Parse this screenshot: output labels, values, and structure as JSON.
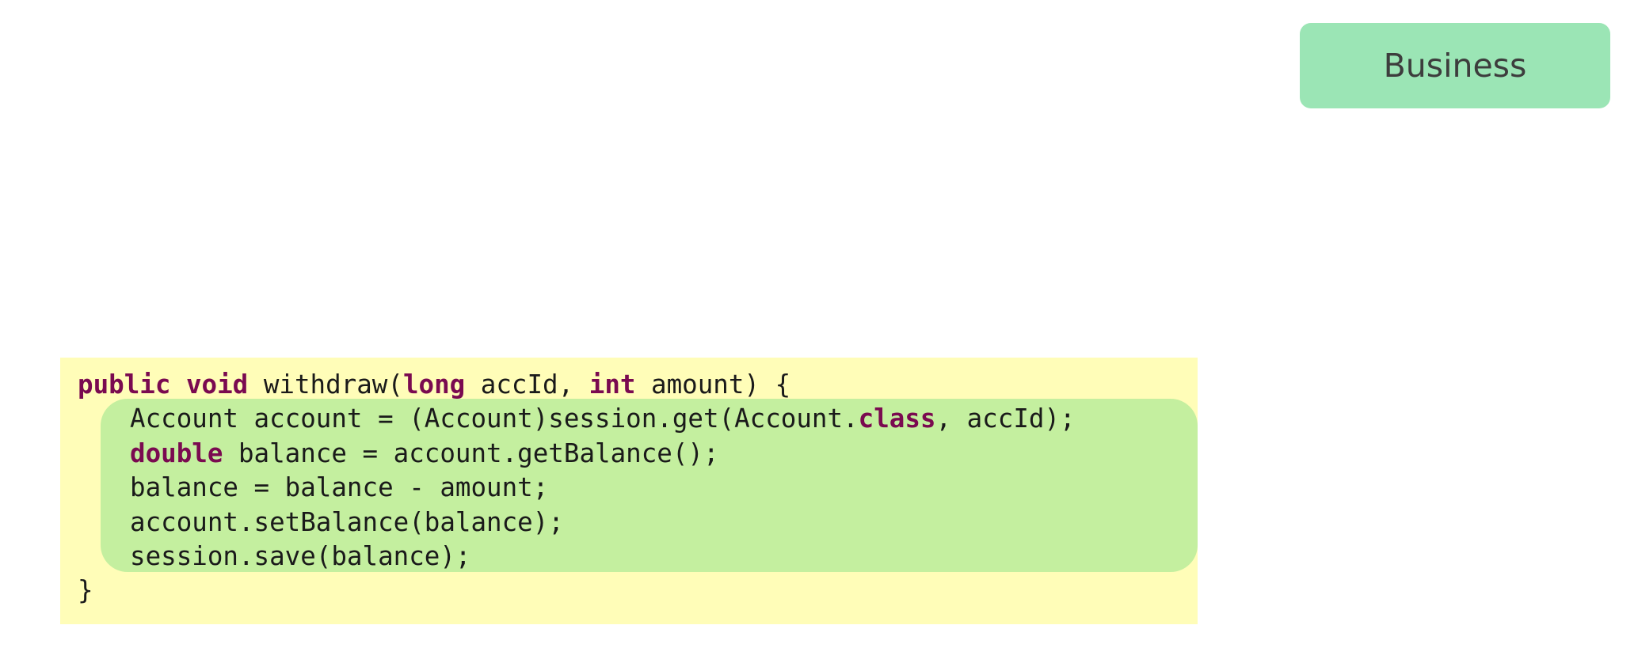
{
  "badge": {
    "label": "Business",
    "color": "#9be5b5"
  },
  "code_panel": {
    "background": "#fffdb8",
    "highlight_color": "#c4ef9f",
    "keyword_color": "#7a0a50",
    "lines": [
      {
        "indent": 0,
        "tokens": [
          {
            "text": "public",
            "kw": true
          },
          {
            "text": " ",
            "kw": false
          },
          {
            "text": "void",
            "kw": true
          },
          {
            "text": " withdraw(",
            "kw": false
          },
          {
            "text": "long",
            "kw": true
          },
          {
            "text": " accId, ",
            "kw": false
          },
          {
            "text": "int",
            "kw": true
          },
          {
            "text": " amount) {",
            "kw": false
          }
        ]
      },
      {
        "indent": 1,
        "tokens": [
          {
            "text": "Account account = (Account)session.get(Account.",
            "kw": false
          },
          {
            "text": "class",
            "kw": true
          },
          {
            "text": ", accId);",
            "kw": false
          }
        ]
      },
      {
        "indent": 1,
        "tokens": [
          {
            "text": "double",
            "kw": true
          },
          {
            "text": " balance = account.getBalance();",
            "kw": false
          }
        ]
      },
      {
        "indent": 1,
        "tokens": [
          {
            "text": "balance = balance - amount;",
            "kw": false
          }
        ]
      },
      {
        "indent": 1,
        "tokens": [
          {
            "text": "account.setBalance(balance);",
            "kw": false
          }
        ]
      },
      {
        "indent": 1,
        "tokens": [
          {
            "text": "session.save(balance);",
            "kw": false
          }
        ]
      },
      {
        "indent": 0,
        "tokens": [
          {
            "text": "}",
            "kw": false
          }
        ]
      }
    ]
  }
}
